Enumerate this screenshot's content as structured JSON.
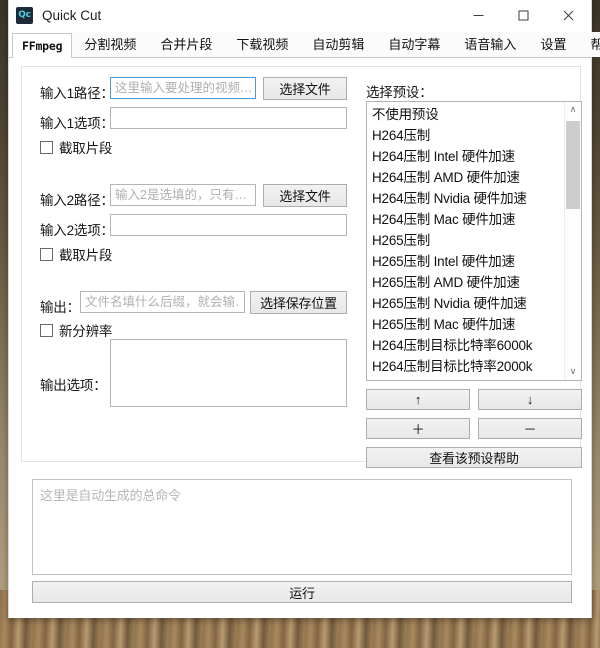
{
  "window": {
    "title": "Quick Cut",
    "icon_label": "Qc",
    "controls": [
      {
        "name": "minimize",
        "glyph": "─"
      },
      {
        "name": "maximize",
        "glyph": "☐"
      },
      {
        "name": "close",
        "glyph": "✕"
      }
    ]
  },
  "tabs": [
    {
      "label": "FFmpeg",
      "active": true
    },
    {
      "label": "分割视频",
      "active": false
    },
    {
      "label": "合并片段",
      "active": false
    },
    {
      "label": "下载视频",
      "active": false
    },
    {
      "label": "自动剪辑",
      "active": false
    },
    {
      "label": "自动字幕",
      "active": false
    },
    {
      "label": "语音输入",
      "active": false
    },
    {
      "label": "设置",
      "active": false
    },
    {
      "label": "帮助",
      "active": false
    }
  ],
  "form": {
    "input1_path_label": "输入1路径：",
    "input1_path_placeholder": "这里输入要处理的视频…",
    "input1_path_value": "",
    "input1_browse_label": "选择文件",
    "input1_opts_label": "输入1选项：",
    "input1_opts_value": "",
    "input1_clip_label": "截取片段",
    "input2_path_label": "输入2路径：",
    "input2_path_placeholder": "输入2是选填的，只有…",
    "input2_path_value": "",
    "input2_browse_label": "选择文件",
    "input2_opts_label": "输入2选项：",
    "input2_opts_value": "",
    "input2_clip_label": "截取片段",
    "output_label": "输出：",
    "output_placeholder": "文件名填什么后缀，就会输…",
    "output_value": "",
    "output_browse_label": "选择保存位置",
    "new_resolution_label": "新分辨率",
    "output_opts_label": "输出选项：",
    "output_opts_value": ""
  },
  "preset": {
    "label": "选择预设：",
    "items": [
      "不使用预设",
      "H264压制",
      "H264压制 Intel 硬件加速",
      "H264压制 AMD 硬件加速",
      "H264压制 Nvidia 硬件加速",
      "H264压制 Mac 硬件加速",
      "H265压制",
      "H265压制 Intel 硬件加速",
      "H265压制 AMD 硬件加速",
      "H265压制 Nvidia 硬件加速",
      "H265压制 Mac 硬件加速",
      "H264压制目标比特率6000k",
      "H264压制目标比特率2000k"
    ],
    "scroll_up_glyph": "∧",
    "scroll_down_glyph": "∨",
    "move_up_label": "↑",
    "move_down_label": "↓",
    "add_label": "＋",
    "remove_label": "－",
    "help_label": "查看该预设帮助"
  },
  "command": {
    "placeholder": "这里是自动生成的总命令",
    "value": "",
    "run_label": "运行"
  },
  "colors": {
    "accent": "#4d9ad6",
    "button_face": "#e8e8e8",
    "border": "#b4b4b4",
    "icon_bg": "#1d2a38",
    "icon_fg": "#4fd0e0"
  }
}
